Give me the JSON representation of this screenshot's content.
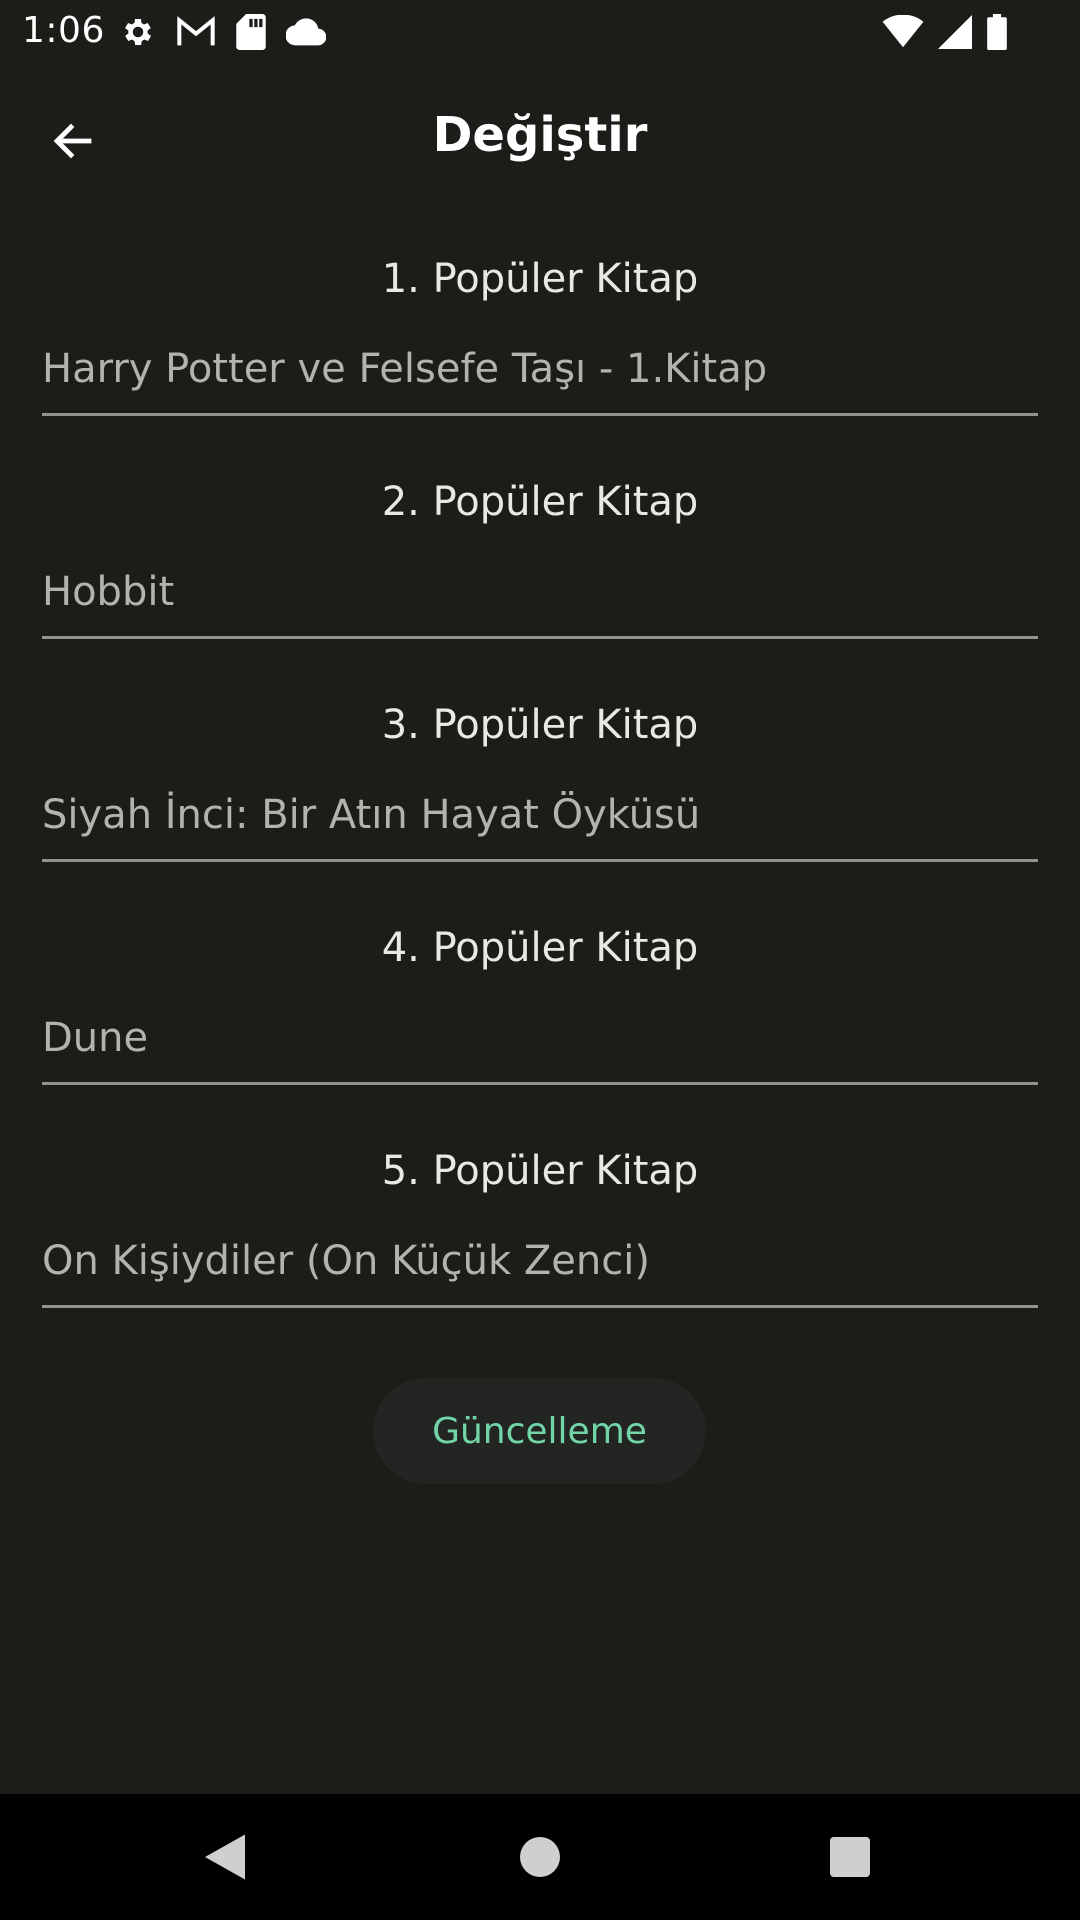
{
  "status_bar": {
    "time": "1:06",
    "left_icons": [
      "gear-icon",
      "gmail-icon",
      "sd-card-icon",
      "cloud-icon"
    ],
    "right_icons": [
      "wifi-icon",
      "signal-icon",
      "battery-icon"
    ]
  },
  "app_bar": {
    "title": "Değiştir",
    "back_icon": "arrow-left-icon"
  },
  "books": [
    {
      "label": "1. Popüler Kitap",
      "value": "Harry Potter ve Felsefe Taşı - 1.Kitap"
    },
    {
      "label": "2. Popüler Kitap",
      "value": "Hobbit"
    },
    {
      "label": "3. Popüler Kitap",
      "value": "Siyah İnci: Bir Atın Hayat Öyküsü"
    },
    {
      "label": "4. Popüler Kitap",
      "value": "Dune"
    },
    {
      "label": "5. Popüler Kitap",
      "value": "On Kişiydiler (On Küçük Zenci)"
    }
  ],
  "update_button": {
    "label": "Güncelleme"
  },
  "nav_bar": {
    "buttons": [
      "back-triangle-icon",
      "home-circle-icon",
      "recents-square-icon"
    ]
  },
  "colors": {
    "background": "#1c1c19",
    "accent": "#72d5a8",
    "underline": "#8f948f"
  }
}
